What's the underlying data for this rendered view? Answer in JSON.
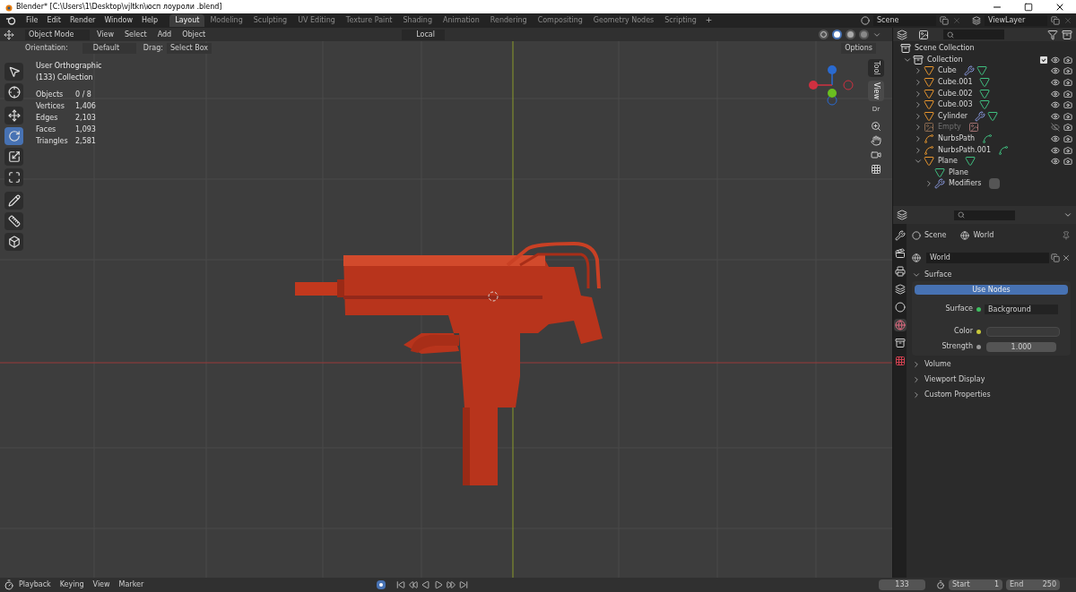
{
  "window": {
    "title": "Blender* [C:\\Users\\1\\Desktop\\vjltkn\\юсп лоуроли .blend]"
  },
  "menu": [
    "File",
    "Edit",
    "Render",
    "Window",
    "Help"
  ],
  "workspaces": [
    {
      "label": "Layout",
      "selected": true
    },
    {
      "label": "Modeling",
      "selected": false
    },
    {
      "label": "Sculpting",
      "selected": false
    },
    {
      "label": "UV Editing",
      "selected": false
    },
    {
      "label": "Texture Paint",
      "selected": false
    },
    {
      "label": "Shading",
      "selected": false
    },
    {
      "label": "Animation",
      "selected": false
    },
    {
      "label": "Rendering",
      "selected": false
    },
    {
      "label": "Compositing",
      "selected": false
    },
    {
      "label": "Geometry Nodes",
      "selected": false
    },
    {
      "label": "Scripting",
      "selected": false
    }
  ],
  "add_workspace": "+",
  "scene": "Scene",
  "view_layer": "ViewLayer",
  "viewport_header": {
    "mode": "Object Mode",
    "menus": [
      "View",
      "Select",
      "Add",
      "Object"
    ],
    "transform": "Local",
    "options": "Options"
  },
  "shading": [
    {
      "kind": "wireframe",
      "selected": false
    },
    {
      "kind": "solid",
      "selected": true
    },
    {
      "kind": "material",
      "selected": false
    },
    {
      "kind": "rendered",
      "selected": false
    }
  ],
  "tool_settings": {
    "orientation_label": "Orientation:",
    "orientation": "Default",
    "drag_label": "Drag:",
    "drag": "Select Box"
  },
  "tools": [
    {
      "kind": "select",
      "selected": false
    },
    {
      "kind": "cursor",
      "selected": false
    },
    {
      "kind": "move",
      "selected": false
    },
    {
      "kind": "rotate",
      "selected": true
    },
    {
      "kind": "scale",
      "selected": false
    },
    {
      "kind": "transform",
      "selected": false
    },
    {
      "kind": "annotate",
      "selected": false
    },
    {
      "kind": "measure",
      "selected": false
    },
    {
      "kind": "add_cube",
      "selected": false
    }
  ],
  "overlay": {
    "view": "User Orthographic",
    "collection": "(133) Collection",
    "stats": [
      {
        "label": "Objects",
        "value": "0 / 8"
      },
      {
        "label": "Vertices",
        "value": "1,406"
      },
      {
        "label": "Edges",
        "value": "2,103"
      },
      {
        "label": "Faces",
        "value": "1,093"
      },
      {
        "label": "Triangles",
        "value": "2,581"
      }
    ]
  },
  "sidebar_tabs": [
    {
      "label": "Tool",
      "selected": false
    },
    {
      "label": "View",
      "selected": true
    }
  ],
  "sidebar_cut": "Dr",
  "outliner": {
    "root": "Scene Collection",
    "items": [
      {
        "name": "Collection",
        "kind": "collection",
        "expanded": true,
        "checked": true,
        "visible": true,
        "disabled": false,
        "children": [
          {
            "name": "Cube",
            "kind": "mesh",
            "expanded": false,
            "visible": true,
            "disabled": false,
            "has_modifier": true
          },
          {
            "name": "Cube.001",
            "kind": "mesh",
            "expanded": false,
            "visible": true,
            "disabled": false,
            "has_modifier": false
          },
          {
            "name": "Cube.002",
            "kind": "mesh",
            "expanded": false,
            "visible": true,
            "disabled": false,
            "has_modifier": false
          },
          {
            "name": "Cube.003",
            "kind": "mesh",
            "expanded": false,
            "visible": true,
            "disabled": false,
            "has_modifier": false
          },
          {
            "name": "Cylinder",
            "kind": "mesh",
            "expanded": false,
            "visible": true,
            "disabled": false,
            "has_modifier": true
          },
          {
            "name": "Empty",
            "kind": "empty",
            "expanded": false,
            "visible": false,
            "disabled": true,
            "has_modifier": false
          },
          {
            "name": "NurbsPath",
            "kind": "curve",
            "expanded": false,
            "visible": true,
            "disabled": false,
            "has_modifier": false
          },
          {
            "name": "NurbsPath.001",
            "kind": "curve",
            "expanded": false,
            "visible": true,
            "disabled": false,
            "has_modifier": false
          },
          {
            "name": "Plane",
            "kind": "mesh",
            "expanded": true,
            "visible": true,
            "disabled": false,
            "has_modifier": false,
            "children": [
              {
                "name": "Plane",
                "kind": "mesh_data"
              },
              {
                "name": "Modifiers",
                "kind": "modifiers",
                "expanded": false
              }
            ]
          }
        ]
      }
    ]
  },
  "properties": {
    "tabs": [
      {
        "kind": "tool",
        "selected": false
      },
      {
        "kind": "render",
        "selected": false
      },
      {
        "kind": "output",
        "selected": false
      },
      {
        "kind": "view_layer",
        "selected": false
      },
      {
        "kind": "scene",
        "selected": false
      },
      {
        "kind": "world",
        "selected": true
      },
      {
        "kind": "collection",
        "selected": false
      },
      {
        "kind": "texture",
        "selected": false
      }
    ],
    "breadcrumb": [
      "Scene",
      "World"
    ],
    "world_name": "World",
    "sections": [
      {
        "title": "Surface",
        "expanded": true
      },
      {
        "title": "Volume",
        "expanded": false
      },
      {
        "title": "Viewport Display",
        "expanded": false
      },
      {
        "title": "Custom Properties",
        "expanded": false
      }
    ],
    "use_nodes": "Use Nodes",
    "fields": [
      {
        "label": "Surface",
        "value": "Background",
        "kind": "shader"
      },
      {
        "label": "Color",
        "kind": "color"
      },
      {
        "label": "Strength",
        "value": "1.000",
        "kind": "number"
      }
    ]
  },
  "timeline": {
    "menus": [
      "Playback",
      "Keying",
      "View",
      "Marker"
    ],
    "frame": "133",
    "start_label": "Start",
    "start": "1",
    "end_label": "End",
    "end": "250"
  }
}
